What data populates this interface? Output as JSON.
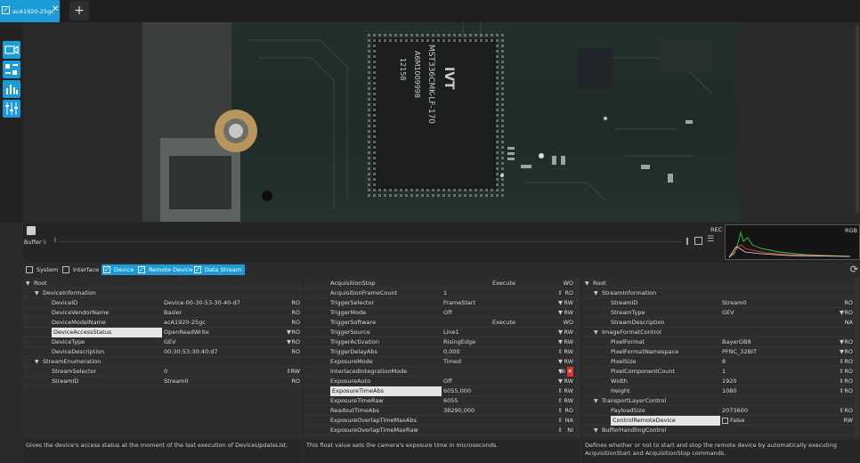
{
  "tab": {
    "check": "✓",
    "title": "acA1920-25gc",
    "close": "✕"
  },
  "add_tab": "+",
  "controls": {
    "buffer_label": "Buffer",
    "buffer_value": "9",
    "rec": "REC",
    "rgb": "RGB"
  },
  "filters": [
    {
      "label": "System",
      "checked": false
    },
    {
      "label": "Interface",
      "checked": false
    },
    {
      "label": "Device",
      "checked": true
    },
    {
      "label": "Remote Device",
      "checked": true
    },
    {
      "label": "Data Stream",
      "checked": true
    }
  ],
  "pcb_text": [
    "IVT",
    "MST336CMK-LF-170",
    "A6M1009998",
    "12158"
  ],
  "colors": {
    "accent": "#1b9bd7",
    "background": "#2b2b2b",
    "error": "#e03030"
  },
  "left_pane": {
    "rows": [
      {
        "level": 0,
        "tree": "▼",
        "name": "Root",
        "value": "",
        "arrow": "",
        "access": ""
      },
      {
        "level": 1,
        "tree": "▼",
        "name": "DeviceInformation",
        "value": "",
        "arrow": "",
        "access": ""
      },
      {
        "level": 2,
        "tree": "",
        "name": "DeviceID",
        "value": "Device-00-30-53-30-40-d7",
        "arrow": "",
        "access": "RO"
      },
      {
        "level": 2,
        "tree": "",
        "name": "DeviceVendorName",
        "value": "Basler",
        "arrow": "",
        "access": "RO"
      },
      {
        "level": 2,
        "tree": "",
        "name": "DeviceModelName",
        "value": "acA1920-25gc",
        "arrow": "",
        "access": "RO"
      },
      {
        "level": 2,
        "tree": "",
        "name": "DeviceAccessStatus",
        "value": "OpenReadWrite",
        "arrow": "▼",
        "access": "RO",
        "selected": true
      },
      {
        "level": 2,
        "tree": "",
        "name": "DeviceType",
        "value": "GEV",
        "arrow": "▼",
        "access": "RO"
      },
      {
        "level": 2,
        "tree": "",
        "name": "DeviceDescription",
        "value": "00:30:53:30:40:d7",
        "arrow": "",
        "access": "RO"
      },
      {
        "level": 1,
        "tree": "▼",
        "name": "StreamEnumeration",
        "value": "",
        "arrow": "",
        "access": ""
      },
      {
        "level": 2,
        "tree": "",
        "name": "StreamSelector",
        "value": "0",
        "arrow": "⇕",
        "access": "RW"
      },
      {
        "level": 2,
        "tree": "",
        "name": "StreamID",
        "value": "Stream0",
        "arrow": "",
        "access": "RO"
      }
    ],
    "description": "Gives the device's access status at the moment of the last execution of DeviceUpdateList."
  },
  "mid_pane": {
    "rows": [
      {
        "name": "AcquisitionStop",
        "value": "",
        "mid": "Execute",
        "arrow": "",
        "access": "WO"
      },
      {
        "name": "AcquisitionFrameCount",
        "value": "1",
        "mid": "",
        "arrow": "⇕",
        "access": "RO"
      },
      {
        "name": "TriggerSelector",
        "value": "FrameStart",
        "mid": "",
        "arrow": "▼",
        "access": "RW"
      },
      {
        "name": "TriggerMode",
        "value": "Off",
        "mid": "",
        "arrow": "▼",
        "access": "RW"
      },
      {
        "name": "TriggerSoftware",
        "value": "",
        "mid": "Execute",
        "arrow": "",
        "access": "WO"
      },
      {
        "name": "TriggerSource",
        "value": "Line1",
        "mid": "",
        "arrow": "▼",
        "access": "RW"
      },
      {
        "name": "TriggerActivation",
        "value": "RisingEdge",
        "mid": "",
        "arrow": "▼",
        "access": "RW"
      },
      {
        "name": "TriggerDelayAbs",
        "value": "0,000",
        "mid": "",
        "arrow": "⇕",
        "access": "RW"
      },
      {
        "name": "ExposureMode",
        "value": "Timed",
        "mid": "",
        "arrow": "▼",
        "access": "RW"
      },
      {
        "name": "InterlacedIntegrationMode",
        "value": "",
        "mid": "",
        "arrow": "▼",
        "access": "NI",
        "error": true
      },
      {
        "name": "ExposureAuto",
        "value": "Off",
        "mid": "",
        "arrow": "▼",
        "access": "RW"
      },
      {
        "name": "ExposureTimeAbs",
        "value": "6055,000",
        "mid": "",
        "arrow": "⇕",
        "access": "RW",
        "selected": true
      },
      {
        "name": "ExposureTimeRaw",
        "value": "6055",
        "mid": "",
        "arrow": "⇕",
        "access": "RW"
      },
      {
        "name": "ReadoutTimeAbs",
        "value": "38290,000",
        "mid": "",
        "arrow": "⇕",
        "access": "RO"
      },
      {
        "name": "ExposureOverlapTimeMaxAbs",
        "value": "",
        "mid": "",
        "arrow": "⇕",
        "access": "NA"
      },
      {
        "name": "ExposureOverlapTimeMaxRaw",
        "value": "",
        "mid": "",
        "arrow": "⇕",
        "access": "NI"
      }
    ],
    "description": "This float value sets the camera's exposure time in microseconds."
  },
  "right_pane": {
    "rows": [
      {
        "level": 0,
        "tree": "▼",
        "name": "Root",
        "value": "",
        "arrow": "",
        "access": ""
      },
      {
        "level": 1,
        "tree": "▼",
        "name": "StreamInformation",
        "value": "",
        "arrow": "",
        "access": ""
      },
      {
        "level": 2,
        "tree": "",
        "name": "StreamID",
        "value": "Stream0",
        "arrow": "",
        "access": "RO"
      },
      {
        "level": 2,
        "tree": "",
        "name": "StreamType",
        "value": "GEV",
        "arrow": "▼",
        "access": "RO"
      },
      {
        "level": 2,
        "tree": "",
        "name": "StreamDescription",
        "value": "",
        "arrow": "",
        "access": "NA"
      },
      {
        "level": 1,
        "tree": "▼",
        "name": "ImageFormatControl",
        "value": "",
        "arrow": "",
        "access": ""
      },
      {
        "level": 2,
        "tree": "",
        "name": "PixelFormat",
        "value": "BayerGB8",
        "arrow": "▼",
        "access": "RO"
      },
      {
        "level": 2,
        "tree": "",
        "name": "PixelFormatNamespace",
        "value": "PFNC_32BIT",
        "arrow": "▼",
        "access": "RO"
      },
      {
        "level": 2,
        "tree": "",
        "name": "PixelSize",
        "value": "8",
        "arrow": "⇕",
        "access": "RO"
      },
      {
        "level": 2,
        "tree": "",
        "name": "PixelComponentCount",
        "value": "1",
        "arrow": "⇕",
        "access": "RO"
      },
      {
        "level": 2,
        "tree": "",
        "name": "Width",
        "value": "1920",
        "arrow": "⇕",
        "access": "RO"
      },
      {
        "level": 2,
        "tree": "",
        "name": "Height",
        "value": "1080",
        "arrow": "⇕",
        "access": "RO"
      },
      {
        "level": 1,
        "tree": "▼",
        "name": "TransportLayerControl",
        "value": "",
        "arrow": "",
        "access": ""
      },
      {
        "level": 2,
        "tree": "",
        "name": "PayloadSize",
        "value": "2073600",
        "arrow": "⇕",
        "access": "RO"
      },
      {
        "level": 2,
        "tree": "",
        "name": "ControlRemoteDevice",
        "value": "False",
        "arrow": "",
        "access": "RW",
        "selected": true,
        "checkbox": true
      },
      {
        "level": 1,
        "tree": "▼",
        "name": "BufferHandlingControl",
        "value": "",
        "arrow": "",
        "access": ""
      }
    ],
    "description": "Defines whether or not to start and stop the remote device by automatically executing AcquisitionStart and AcquisitionStop commands."
  }
}
